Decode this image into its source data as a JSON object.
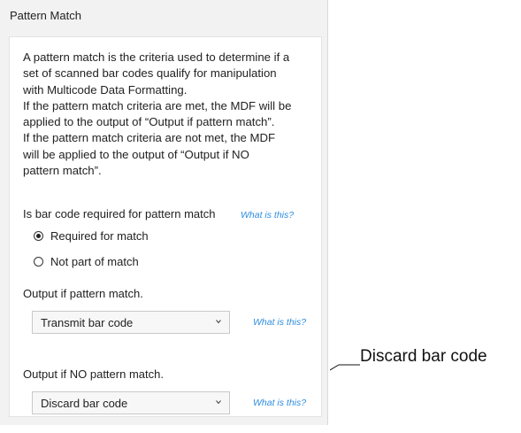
{
  "panel": {
    "title": "Pattern Match"
  },
  "description": "A pattern match is the criteria used to determine if a\nset of scanned bar codes qualify for manipulation\nwith Multicode Data Formatting.\nIf the pattern match criteria are met, the MDF will be\napplied to the output of “Output if pattern match”.\nIf the pattern match criteria are not met, the MDF\nwill be applied to the output of “Output if NO\npattern match”.",
  "required_question": {
    "label": "Is bar code required for pattern match",
    "help_link": "What is this?"
  },
  "radio_options": [
    {
      "label": "Required for match",
      "selected": true
    },
    {
      "label": "Not part of match",
      "selected": false
    }
  ],
  "output_match": {
    "label": "Output if pattern match.",
    "selected_value": "Transmit bar code",
    "help_link": "What is this?"
  },
  "output_no_match": {
    "label": "Output if NO pattern match.",
    "selected_value": "Discard bar code",
    "help_link": "What is this?"
  },
  "callout": {
    "text": "Discard bar code"
  },
  "colors": {
    "link": "#2f8ee0",
    "panel_bg": "#f2f2f2",
    "card_bg": "#ffffff"
  },
  "icons": {
    "dropdown": "chevron-down-icon",
    "radio_selected": "radio-checked-icon",
    "radio_unselected": "radio-unchecked-icon"
  }
}
